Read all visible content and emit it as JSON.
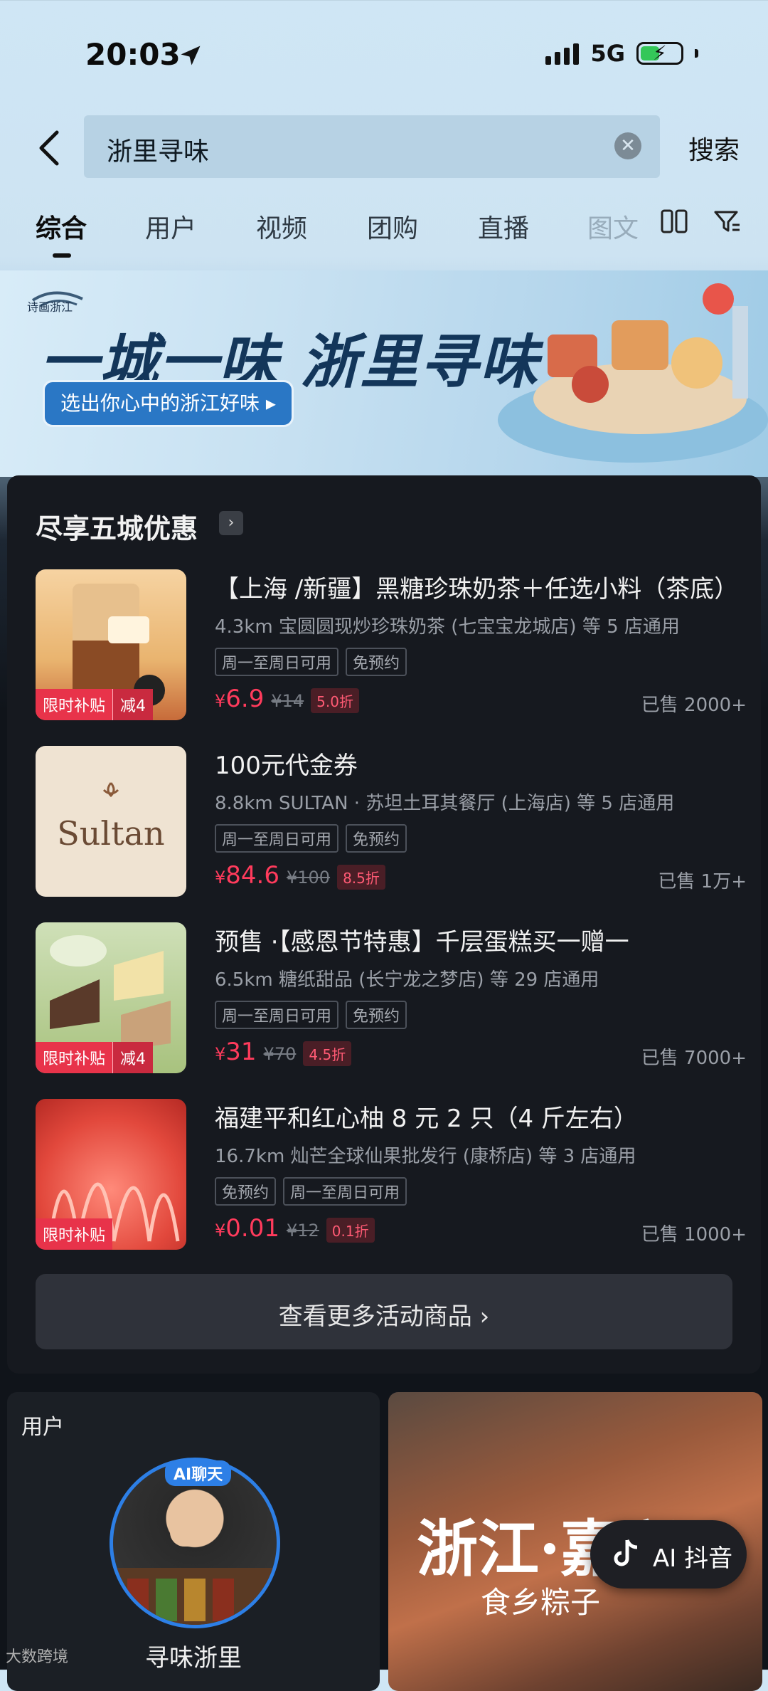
{
  "status": {
    "time": "20:03",
    "network": "5G"
  },
  "search": {
    "query": "浙里寻味",
    "button": "搜索"
  },
  "tabs": [
    {
      "label": "综合"
    },
    {
      "label": "用户"
    },
    {
      "label": "视频"
    },
    {
      "label": "团购"
    },
    {
      "label": "直播"
    },
    {
      "label": "图文"
    }
  ],
  "banner": {
    "logo_text": "诗画浙江",
    "title": "一城一味 浙里寻味",
    "pill": "选出你心中的浙江好味 ▸"
  },
  "deals": {
    "title": "尽享五城优惠",
    "items": [
      {
        "title": "【上海 /新疆】黑糖珍珠奶茶＋任选小料（茶底）",
        "sub": "4.3km   宝圆圆现炒珍珠奶茶 (七宝宝龙城店) 等 5 店通用",
        "chips": [
          "周一至周日可用",
          "免预约"
        ],
        "currency": "¥",
        "price": "6.9",
        "orig": "¥14",
        "discount": "5.0折",
        "sold": "已售 2000+",
        "tags": [
          "限时补贴",
          "减4"
        ]
      },
      {
        "title": "100元代金券",
        "sub": "8.8km   SULTAN · 苏坦土耳其餐厅 (上海店) 等 5 店通用",
        "chips": [
          "周一至周日可用",
          "免预约"
        ],
        "currency": "¥",
        "price": "84.6",
        "orig": "¥100",
        "discount": "8.5折",
        "sold": "已售 1万+",
        "logo": "Sultan"
      },
      {
        "title": "预售 ·【感恩节特惠】千层蛋糕买一赠一",
        "sub": "6.5km   糖纸甜品 (长宁龙之梦店) 等 29 店通用",
        "chips": [
          "周一至周日可用",
          "免预约"
        ],
        "currency": "¥",
        "price": "31",
        "orig": "¥70",
        "discount": "4.5折",
        "sold": "已售 7000+",
        "tags": [
          "限时补贴",
          "减4"
        ]
      },
      {
        "title": "福建平和红心柚 8 元 2 只（4 斤左右）",
        "sub": "16.7km   灿芒全球仙果批发行 (康桥店) 等 3 店通用",
        "chips": [
          "免预约",
          "周一至周日可用"
        ],
        "currency": "¥",
        "price": "0.01",
        "orig": "¥12",
        "discount": "0.1折",
        "sold": "已售 1000+",
        "tags": [
          "限时补贴"
        ]
      }
    ],
    "more": "查看更多活动商品"
  },
  "user_card": {
    "label": "用户",
    "badge": "AI聊天",
    "name": "寻味浙里"
  },
  "video_card": {
    "title": "浙江·嘉兴",
    "sub": "食乡粽子"
  },
  "ai_float": {
    "label": "AI 抖音"
  },
  "watermark": "大数跨境",
  "colors": {
    "price": "#ff3b5c",
    "accent_blue": "#2d7fe6",
    "card_bg": "#16191f"
  }
}
